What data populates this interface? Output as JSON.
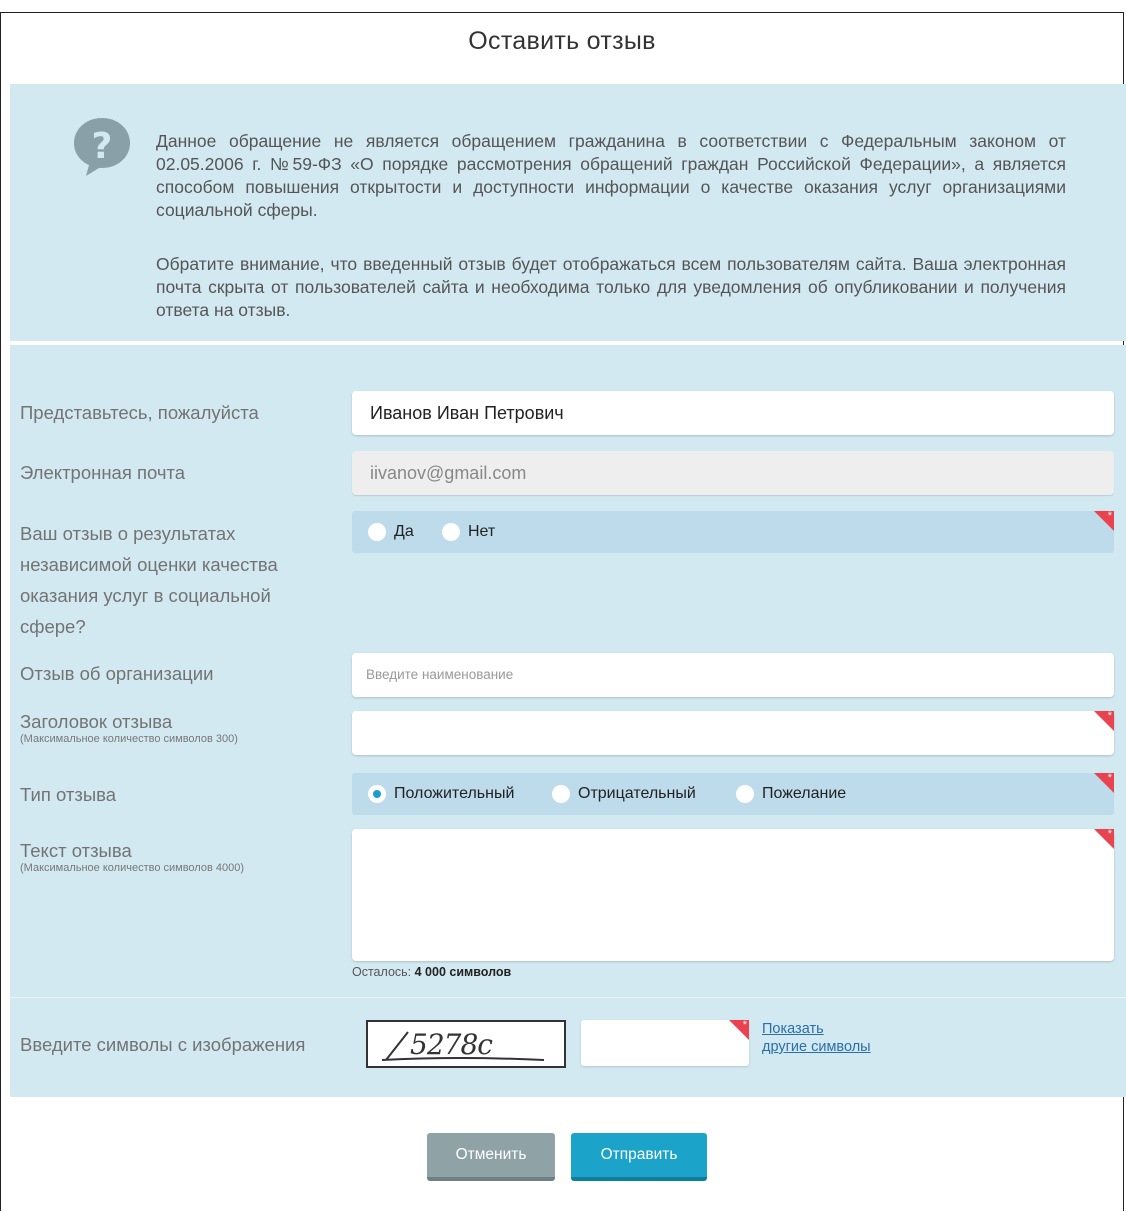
{
  "dialog": {
    "title": "Оставить отзыв"
  },
  "info": {
    "paragraph1": "Данное обращение не является обращением гражданина в соответствии с Федеральным законом от 02.05.2006 г. №59-ФЗ «О порядке рассмотрения обращений граждан Российской Федерации», а является способом повышения открытости и доступности информации о качестве оказания услуг организациями социальной сферы.",
    "paragraph2": "Обратите внимание, что введенный отзыв будет отображаться всем пользователям сайта. Ваша электронная почта скрыта от пользователей сайта и необходима только для уведомления об опубликовании и получения ответа на отзыв."
  },
  "form": {
    "name": {
      "label": "Представьтесь, пожалуйста",
      "value": "Иванов Иван Петрович"
    },
    "email": {
      "label": "Электронная почта",
      "value": "iivanov@gmail.com"
    },
    "result_question": {
      "label": "Ваш отзыв о результатах независимой оценки качества оказания услуг в социальной сфере?",
      "options": [
        "Да",
        "Нет"
      ]
    },
    "organization": {
      "label": "Отзыв об организации",
      "placeholder": "Введите наименование"
    },
    "review_title": {
      "label": "Заголовок отзыва",
      "sublabel": "(Максимальное количество символов 300)",
      "value": ""
    },
    "review_type": {
      "label": "Тип отзыва",
      "options": [
        "Положительный",
        "Отрицательный",
        "Пожелание"
      ],
      "selected": "Положительный"
    },
    "review_text": {
      "label": "Текст отзыва",
      "sublabel": "(Максимальное количество символов 4000)",
      "remaining_prefix": "Осталось:",
      "remaining_value": "4 000 символов"
    },
    "captcha": {
      "label": "Введите символы с изображения",
      "image_text": "5278c",
      "link_line1": "Показать",
      "link_line2": "другие символы"
    },
    "required_mark": "*"
  },
  "buttons": {
    "cancel": "Отменить",
    "submit": "Отправить"
  },
  "colors": {
    "panel": "#d3e9f2",
    "radio_bar": "#bddbea",
    "required": "#e8434f",
    "submit": "#1ba3c9",
    "cancel": "#8fa2a6"
  },
  "icons": {
    "info": "question-icon"
  }
}
